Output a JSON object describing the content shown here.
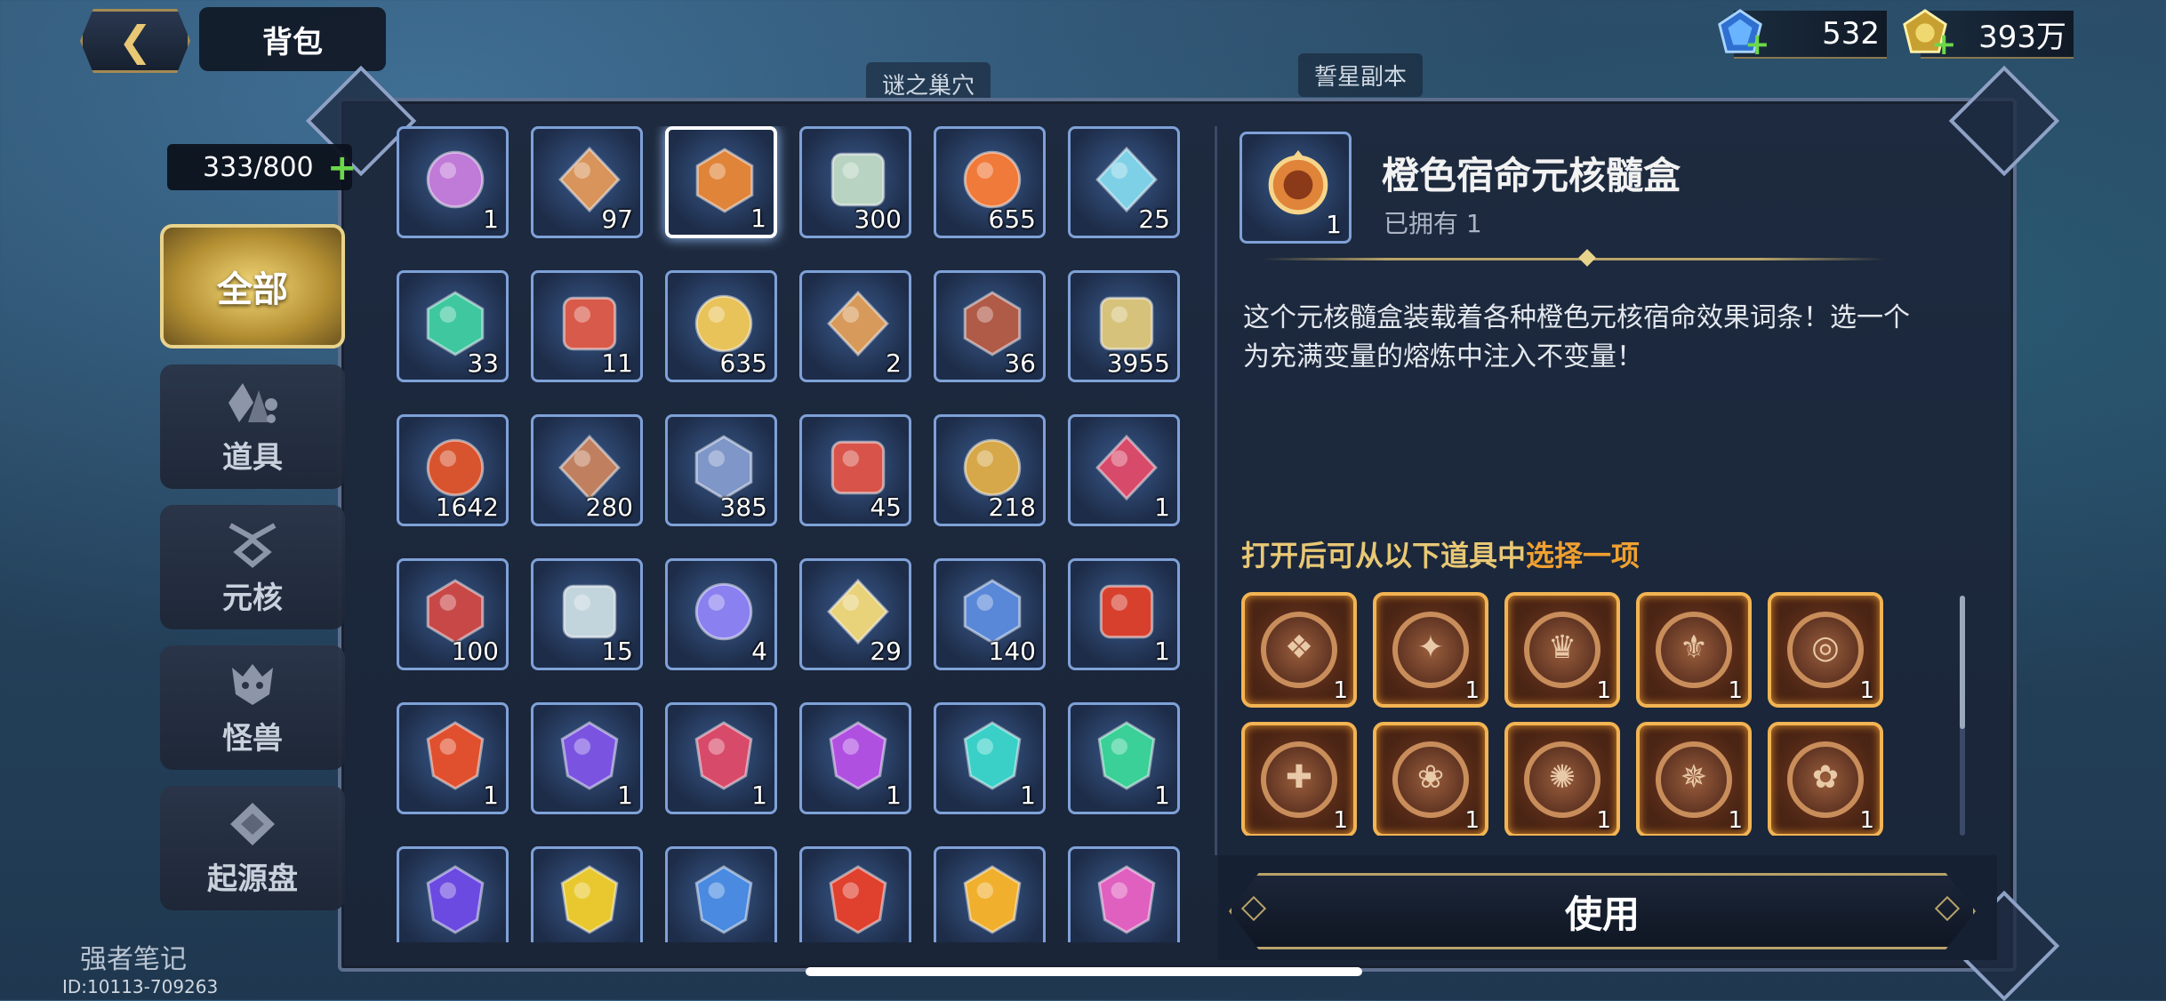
{
  "header": {
    "back_icon": "back-arrow-icon",
    "title": "背包"
  },
  "currencies": [
    {
      "icon": "blue-gem-icon",
      "value": "532",
      "color": "#4aa3ff"
    },
    {
      "icon": "gold-coin-icon",
      "value": "393万",
      "color": "#e8c35a"
    }
  ],
  "background_labels": [
    "谜之巢穴",
    "誓星副本",
    "强者笔记"
  ],
  "sidebar": {
    "capacity": "333/800",
    "tabs": [
      {
        "label": "全部",
        "icon": "",
        "active": true
      },
      {
        "label": "道具",
        "icon": "items-icon",
        "active": false
      },
      {
        "label": "元核",
        "icon": "core-icon",
        "active": false
      },
      {
        "label": "怪兽",
        "icon": "monster-icon",
        "active": false
      },
      {
        "label": "起源盘",
        "icon": "origin-disc-icon",
        "active": false
      }
    ]
  },
  "items": [
    {
      "icon": "purple-infinity-potion-icon",
      "count": "1",
      "color": "#c07ad8"
    },
    {
      "icon": "brown-bottle-icon",
      "count": "97",
      "color": "#d8945a"
    },
    {
      "icon": "orange-core-box-icon",
      "count": "1",
      "color": "#e0843a",
      "selected": true
    },
    {
      "icon": "broken-sword-icon",
      "count": "300",
      "color": "#b9d3c2"
    },
    {
      "icon": "fire-spirit-icon",
      "count": "655",
      "color": "#f07a3a"
    },
    {
      "icon": "puzzle-piece-icon",
      "count": "25",
      "color": "#7ed0e6"
    },
    {
      "icon": "green-orb-icon",
      "count": "33",
      "color": "#3fc8a0"
    },
    {
      "icon": "red-orb-icon",
      "count": "11",
      "color": "#d85a4a"
    },
    {
      "icon": "winged-star-icon",
      "count": "635",
      "color": "#e8c35a"
    },
    {
      "icon": "magnifier-card-icon",
      "count": "2",
      "color": "#d89a5a"
    },
    {
      "icon": "hourglass-shield-icon",
      "count": "36",
      "color": "#b05a48"
    },
    {
      "icon": "gold-ore-icon",
      "count": "3955",
      "color": "#d6c27a"
    },
    {
      "icon": "red-rune-icon",
      "count": "1642",
      "color": "#d8542e"
    },
    {
      "icon": "bronze-plate-icon",
      "count": "280",
      "color": "#c08060"
    },
    {
      "icon": "blue-crest-icon",
      "count": "385",
      "color": "#7e96c8"
    },
    {
      "icon": "red-crystal-icon",
      "count": "45",
      "color": "#d8544a"
    },
    {
      "icon": "gold-ring-icon",
      "count": "218",
      "color": "#d6a84a"
    },
    {
      "icon": "crossed-blades-icon",
      "count": "1",
      "color": "#d84a6a"
    },
    {
      "icon": "red-badge-icon",
      "count": "100",
      "color": "#c84848"
    },
    {
      "icon": "silver-ore-icon",
      "count": "15",
      "color": "#c2d4dc"
    },
    {
      "icon": "blue-vortex-icon",
      "count": "4",
      "color": "#8a80f0"
    },
    {
      "icon": "gold-ticket-icon",
      "count": "29",
      "color": "#e8d27a"
    },
    {
      "icon": "blue-shield-icon",
      "count": "140",
      "color": "#5a88d8"
    },
    {
      "icon": "red-emblem-icon",
      "count": "1",
      "color": "#d8402e"
    },
    {
      "icon": "red-gem-core-icon",
      "count": "1",
      "color": "#e0502e"
    },
    {
      "icon": "purple-gem-core-icon",
      "count": "1",
      "color": "#7a54e0"
    },
    {
      "icon": "crimson-gem-core-icon",
      "count": "1",
      "color": "#d84a6a"
    },
    {
      "icon": "violet-gem-core-icon",
      "count": "1",
      "color": "#b050e0"
    },
    {
      "icon": "teal-gem-core-icon",
      "count": "1",
      "color": "#3ad0c8"
    },
    {
      "icon": "green-gem-core-icon",
      "count": "1",
      "color": "#3ad098"
    },
    {
      "icon": "indigo-gem-core-icon",
      "count": "",
      "color": "#6a4ae0"
    },
    {
      "icon": "yellow-gem-core-icon",
      "count": "",
      "color": "#e8c82e"
    },
    {
      "icon": "blue-gem-core-icon",
      "count": "",
      "color": "#4a8ae0"
    },
    {
      "icon": "scarlet-gem-core-icon",
      "count": "",
      "color": "#e0402e"
    },
    {
      "icon": "amber-gem-core-icon",
      "count": "",
      "color": "#f0b02e"
    },
    {
      "icon": "pink-gem-core-icon",
      "count": "",
      "color": "#e060c0"
    }
  ],
  "detail": {
    "icon": "orange-core-box-icon",
    "icon_count": "1",
    "name": "橙色宿命元核髓盒",
    "owned": "已拥有 1",
    "description": "这个元核髓盒装载着各种橙色元核宿命效果词条！选一个为充满变量的熔炼中注入不变量！",
    "hint_prefix": "打开后可从以下道具中",
    "hint_highlight": "选择一项",
    "options": [
      {
        "icon": "orange-core-option-icon",
        "glyph": "❖",
        "count": "1"
      },
      {
        "icon": "orange-core-option-icon",
        "glyph": "✦",
        "count": "1"
      },
      {
        "icon": "orange-core-option-icon",
        "glyph": "♛",
        "count": "1"
      },
      {
        "icon": "orange-core-option-icon",
        "glyph": "⚜",
        "count": "1"
      },
      {
        "icon": "orange-core-option-icon",
        "glyph": "◎",
        "count": "1"
      },
      {
        "icon": "orange-core-option-icon",
        "glyph": "✚",
        "count": "1"
      },
      {
        "icon": "orange-core-option-icon",
        "glyph": "❀",
        "count": "1"
      },
      {
        "icon": "orange-core-option-icon",
        "glyph": "✺",
        "count": "1"
      },
      {
        "icon": "orange-core-option-icon",
        "glyph": "✵",
        "count": "1"
      },
      {
        "icon": "orange-core-option-icon",
        "glyph": "✿",
        "count": "1"
      }
    ],
    "use_label": "使用"
  },
  "uid": "ID:10113-709263"
}
